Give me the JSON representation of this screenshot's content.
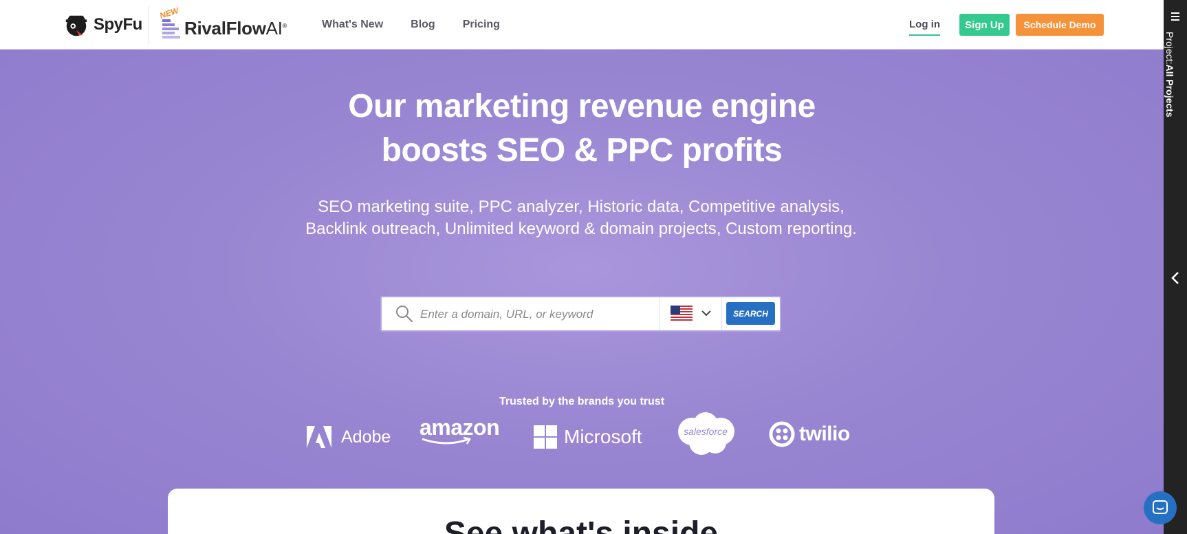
{
  "header": {
    "spyfu_logo": "SpyFu",
    "rival_new_badge": "NEW",
    "rival_logo_main": "RivalFlow",
    "rival_logo_ai": "AI",
    "rival_logo_reg": "®",
    "nav": [
      {
        "label": "What's New"
      },
      {
        "label": "Blog"
      },
      {
        "label": "Pricing"
      }
    ],
    "login_label": "Log in",
    "signup_label": "Sign Up",
    "demo_label": "Schedule Demo"
  },
  "side_panel": {
    "label_prefix": "Project:",
    "label_value": "All Projects"
  },
  "hero": {
    "headline_line1": "Our marketing revenue engine",
    "headline_line2": "boosts SEO & PPC profits",
    "subhead": "SEO marketing suite, PPC analyzer, Historic data, Competitive analysis, Backlink outreach, Unlimited keyword & domain projects, Custom reporting.",
    "search": {
      "placeholder": "Enter a domain, URL, or keyword",
      "value": "",
      "country": "us-flag-icon",
      "button_label": "SEARCH"
    },
    "trusted_label": "Trusted by the brands you trust",
    "brands": [
      {
        "name": "Adobe"
      },
      {
        "name": "amazon"
      },
      {
        "name": "Microsoft"
      },
      {
        "name": "salesforce"
      },
      {
        "name": "twilio"
      }
    ]
  },
  "card": {
    "title_partial": "See what's inside"
  },
  "colors": {
    "hero_bg": "#9a86d3",
    "signup": "#34c98e",
    "demo": "#f6923a",
    "search_button": "#2670c4",
    "side_panel": "#232323"
  }
}
